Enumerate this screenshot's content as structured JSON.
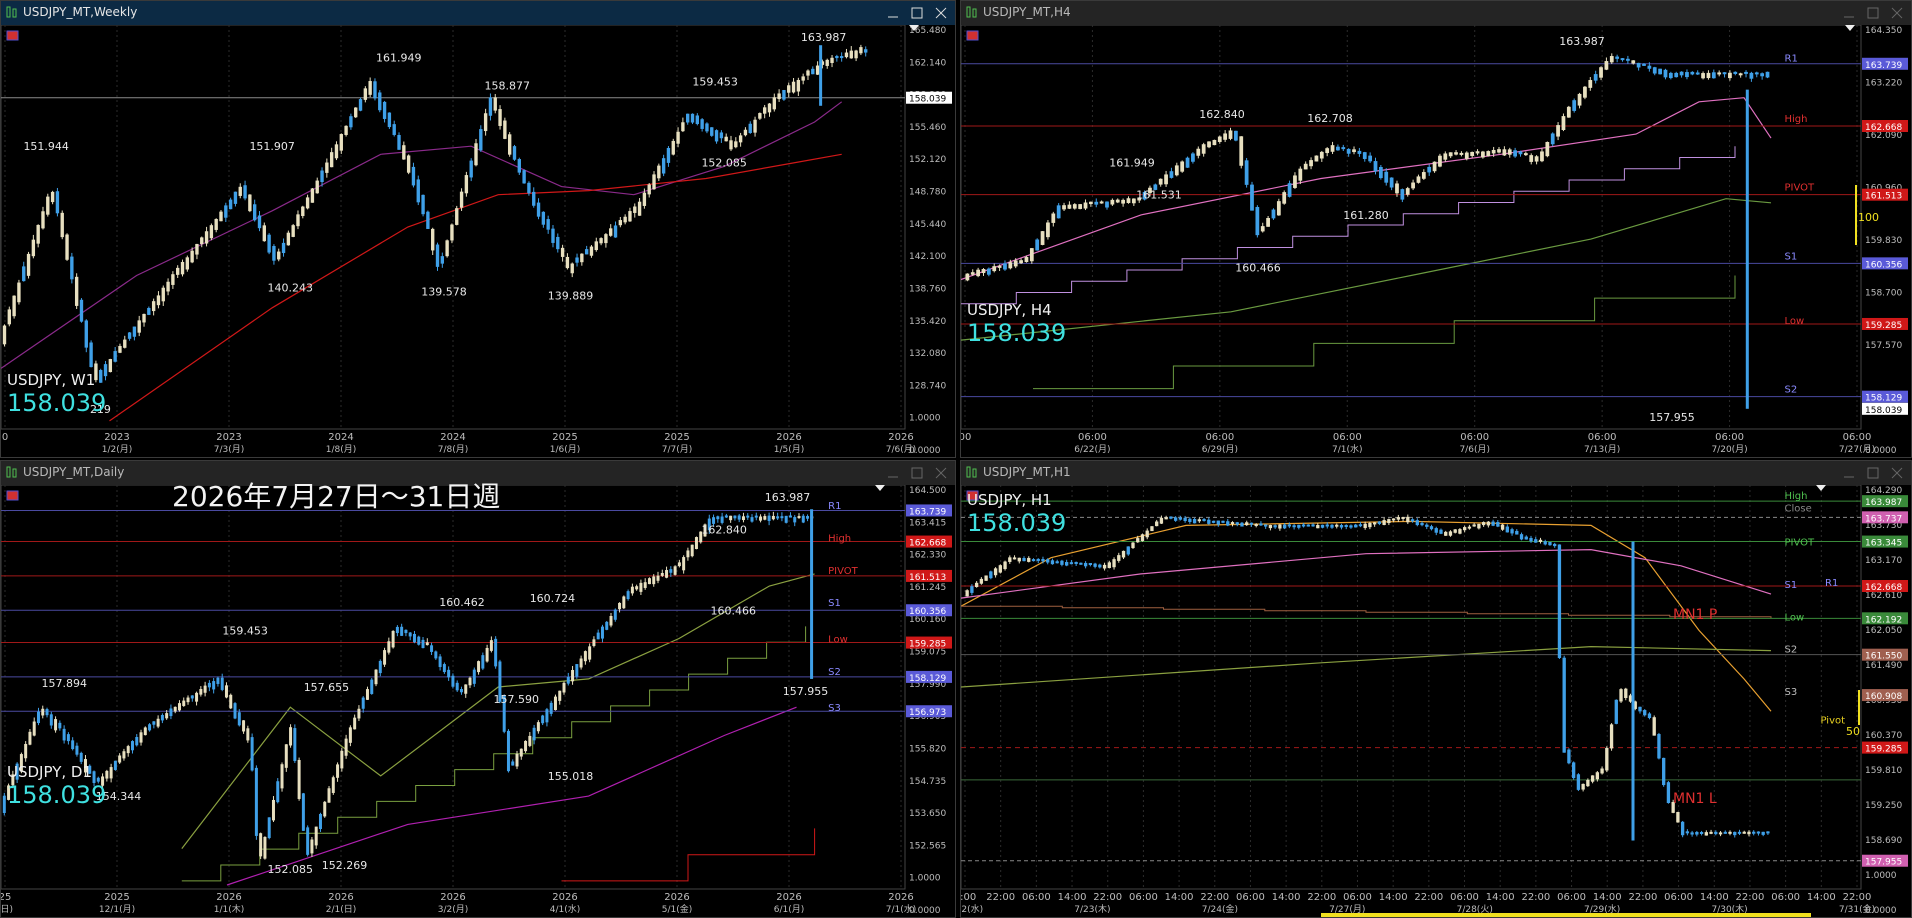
{
  "windows": [
    {
      "id": "weekly",
      "title": "USDJPY_MT,Weekly",
      "active": true,
      "symbol_label": "USDJPY, W1",
      "price": "158.039",
      "price_color": "#3fe0e0",
      "price_axis": [
        "165.480",
        "162.140",
        "158.800",
        "155.460",
        "152.120",
        "148.780",
        "145.440",
        "142.100",
        "138.760",
        "135.420",
        "132.080",
        "128.740",
        "1.0000",
        "0.0000"
      ],
      "current_price_tag": "158.039",
      "time_axis": [
        "0",
        "2023",
        "2023",
        "2024",
        "2024",
        "2025",
        "2025",
        "2026",
        "2026"
      ],
      "time_axis_sub": [
        "",
        "1/2(月)",
        "7/3(月)",
        "1/8(月)",
        "7/8(月)",
        "1/6(月)",
        "7/7(月)",
        "1/5(月)",
        "7/6(月)"
      ],
      "peaks": [
        "151.944",
        "151.907",
        "161.949",
        "158.877",
        "159.453",
        "163.987",
        "140.243",
        "139.578",
        "139.889",
        "152.085",
        "219"
      ]
    },
    {
      "id": "h4",
      "title": "USDJPY_MT,H4",
      "active": false,
      "symbol_label": "USDJPY, H4",
      "price": "158.039",
      "price_color": "#3fe0e0",
      "price_axis": [
        "164.350",
        "163.220",
        "162.090",
        "160.960",
        "159.830",
        "158.700",
        "157.570",
        "1.0000",
        "0.0000"
      ],
      "level_labels": [
        "R1",
        "High",
        "PIVOT",
        "S1",
        "Low",
        "S2"
      ],
      "level_tags": [
        "163.739",
        "162.668",
        "161.513",
        "160.356",
        "159.285",
        "158.129",
        "158.039"
      ],
      "time_axis": [
        "00",
        "06:00",
        "06:00",
        "06:00",
        "06:00",
        "06:00",
        "06:00",
        "06:00"
      ],
      "time_axis_sub": [
        "",
        "6/22(月)",
        "6/29(月)",
        "7/1(水)",
        "7/6(月)",
        "7/13(月)",
        "7/20(月)",
        "7/27(月)"
      ],
      "peaks": [
        "161.949",
        "161.531",
        "162.840",
        "162.708",
        "161.280",
        "160.466",
        "163.987",
        "157.955"
      ],
      "side_label": "100"
    },
    {
      "id": "daily",
      "title": "USDJPY_MT,Daily",
      "active": false,
      "symbol_label": "USDJPY, D1",
      "price": "158.039",
      "price_color": "#3fe0e0",
      "price_axis": [
        "164.500",
        "163.415",
        "162.330",
        "161.245",
        "160.160",
        "159.075",
        "157.990",
        "156.905",
        "155.820",
        "154.735",
        "153.650",
        "152.565",
        "1.0000",
        "0.0000"
      ],
      "level_labels": [
        "R1",
        "High",
        "PIVOT",
        "S1",
        "Low",
        "S2",
        "S3"
      ],
      "level_tags": [
        "163.739",
        "162.668",
        "161.513",
        "160.356",
        "159.285",
        "158.129",
        "156.973"
      ],
      "time_axis": [
        "25",
        "2025",
        "2026",
        "2026",
        "2026",
        "2026",
        "2026",
        "2026",
        "2026"
      ],
      "time_axis_sub": [
        "(日)",
        "12/1(月)",
        "1/1(木)",
        "2/1(日)",
        "3/2(月)",
        "4/1(水)",
        "5/1(金)",
        "6/1(月)",
        "7/1(水)"
      ],
      "peaks": [
        "157.894",
        "154.344",
        "159.453",
        "157.655",
        "152.085",
        "152.269",
        "160.462",
        "157.590",
        "160.724",
        "155.018",
        "162.840",
        "160.466",
        "163.987",
        "157.955"
      ]
    },
    {
      "id": "h1",
      "title": "USDJPY_MT,H1",
      "active": false,
      "symbol_label": "USDJPY, H1",
      "price": "158.039",
      "price_color": "#3fe0e0",
      "price_axis": [
        "164.290",
        "163.730",
        "163.170",
        "162.610",
        "162.050",
        "161.490",
        "160.930",
        "160.370",
        "159.810",
        "159.250",
        "158.690",
        "1.0000",
        "0.0000"
      ],
      "level_labels": [
        "High",
        "Close",
        "PIVOT",
        "S1",
        "R1",
        "Low",
        "S2",
        "S3",
        "Pivot"
      ],
      "level_tags": [
        "163.987",
        "163.737",
        "163.345",
        "162.668",
        "162.192",
        "161.550",
        "160.908",
        "159.285",
        "157.955"
      ],
      "mn_labels": [
        "MN1 P",
        "MN1 L"
      ],
      "side_label": "50",
      "time_axis": [
        "4:00",
        "22:00",
        "06:00",
        "14:00",
        "22:00",
        "06:00",
        "14:00",
        "22:00",
        "06:00",
        "14:00",
        "22:00",
        "06:00",
        "14:00",
        "22:00",
        "06:00",
        "14:00",
        "22:00",
        "06:00",
        "14:00",
        "22:00",
        "06:00",
        "14:00",
        "22:00",
        "06:00",
        "14:00",
        "22:00"
      ],
      "time_axis_sub": [
        "7/22(水)",
        "7/23(木)",
        "7/24(金)",
        "7/27(月)",
        "7/28(火)",
        "7/29(水)",
        "7/30(木)",
        "7/31(金)"
      ]
    }
  ],
  "overlay_title": "2026年7月27日～31日週",
  "colors": {
    "bull": "#e8e0c0",
    "bear": "#3fa0e8",
    "grid": "#2a2a2a",
    "r_level": "#6a6adc",
    "red_level": "#d01818",
    "pivot_level": "#d01818",
    "ma_pink": "#d060b0",
    "ma_green": "#7aa040",
    "ma_red": "#d01818",
    "ma_orange": "#e8a030",
    "yellow": "#f0e020"
  }
}
